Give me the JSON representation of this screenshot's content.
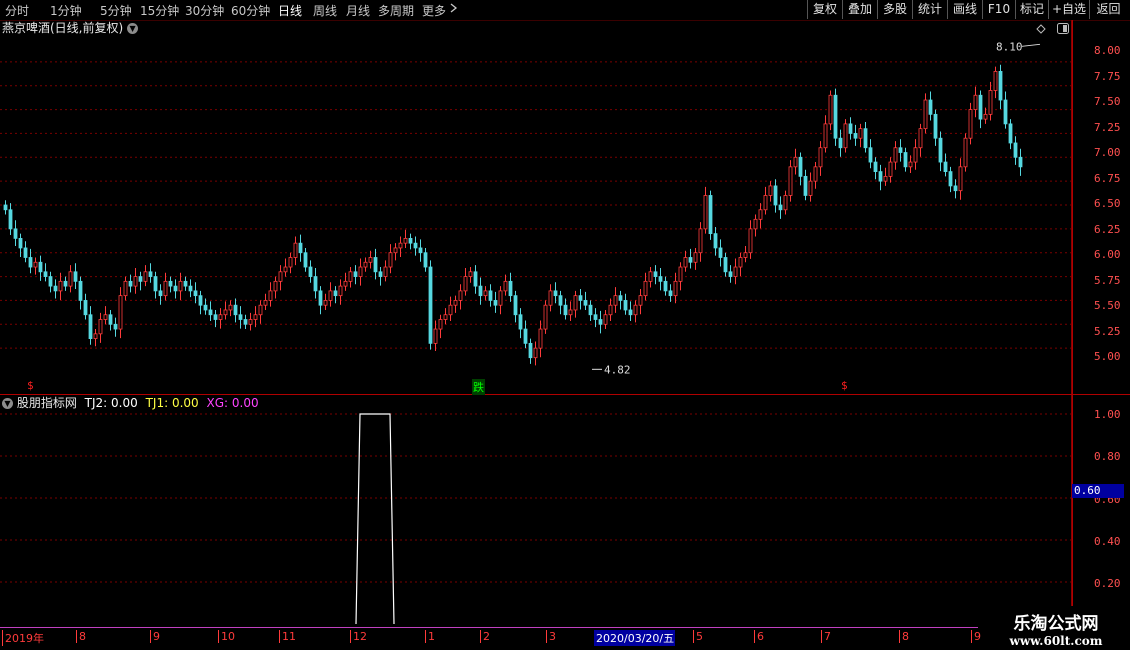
{
  "toolbar": {
    "periods": [
      "分时",
      "1分钟",
      "5分钟",
      "15分钟",
      "30分钟",
      "60分钟",
      "日线",
      "周线",
      "月线",
      "多周期",
      "更多"
    ],
    "active_period": "日线",
    "more_arrow": "chevron-right-icon",
    "buttons": [
      "复权",
      "叠加",
      "多股",
      "统计",
      "画线",
      "F10",
      "标记",
      "+自选",
      "返回"
    ]
  },
  "main_chart": {
    "title": "燕京啤酒(日线,前复权)",
    "y_labels": [
      "8.00",
      "7.75",
      "7.50",
      "7.25",
      "7.00",
      "6.75",
      "6.50",
      "6.25",
      "6.00",
      "5.75",
      "5.50",
      "5.25",
      "5.00"
    ],
    "high_label": "8.10",
    "low_label": "4.82",
    "markers": [
      {
        "text": "$",
        "color": "#ff2020"
      },
      {
        "text": "跌",
        "color": "#00ff00"
      },
      {
        "text": "$",
        "color": "#ff2020"
      }
    ],
    "colors": {
      "up": "#ff3b3b",
      "down": "#56d8e0",
      "grid": "#7a0000",
      "axis": "#b00000"
    }
  },
  "indicator": {
    "name": "股朋指标网",
    "values": [
      {
        "label": "TJ2: 0.00",
        "color": "#ffffff"
      },
      {
        "label": "TJ1: 0.00",
        "color": "#ffff44"
      },
      {
        "label": "XG: 0.00",
        "color": "#ff44ff"
      }
    ],
    "y_labels": [
      "1.00",
      "0.80",
      "0.60",
      "0.40",
      "0.20"
    ],
    "current_value": "0.60",
    "signal": {
      "from_x_index": 71,
      "to_x_index": 77,
      "level": 1.0
    }
  },
  "time_axis": {
    "labels": [
      "2019年",
      "8",
      "9",
      "10",
      "11",
      "12",
      "1",
      "2",
      "3",
      "2020/03/20/五",
      "5",
      "6",
      "7",
      "8",
      "9"
    ]
  },
  "watermark": {
    "line1": "乐淘公式网",
    "line2": "www.60lt.com"
  },
  "chart_data": {
    "type": "candlestick",
    "title": "燕京啤酒(日线,前复权)",
    "ylim": [
      4.75,
      8.25
    ],
    "annotations": [
      {
        "text": "8.10",
        "value": 8.1
      },
      {
        "text": "4.82",
        "value": 4.82
      }
    ],
    "closes": [
      6.45,
      6.25,
      6.15,
      6.05,
      5.95,
      5.85,
      5.9,
      5.8,
      5.75,
      5.65,
      5.6,
      5.7,
      5.65,
      5.8,
      5.7,
      5.5,
      5.35,
      5.1,
      5.15,
      5.3,
      5.35,
      5.25,
      5.2,
      5.55,
      5.7,
      5.65,
      5.75,
      5.7,
      5.8,
      5.75,
      5.6,
      5.55,
      5.7,
      5.65,
      5.6,
      5.7,
      5.65,
      5.6,
      5.55,
      5.45,
      5.4,
      5.35,
      5.3,
      5.35,
      5.4,
      5.45,
      5.35,
      5.3,
      5.25,
      5.3,
      5.35,
      5.45,
      5.5,
      5.6,
      5.7,
      5.8,
      5.85,
      5.95,
      6.1,
      6.0,
      5.85,
      5.75,
      5.6,
      5.45,
      5.5,
      5.6,
      5.55,
      5.65,
      5.7,
      5.8,
      5.75,
      5.85,
      5.9,
      5.95,
      5.8,
      5.75,
      5.85,
      6.0,
      6.05,
      6.1,
      6.15,
      6.1,
      6.05,
      6.0,
      5.85,
      5.05,
      5.2,
      5.3,
      5.35,
      5.45,
      5.5,
      5.6,
      5.75,
      5.8,
      5.65,
      5.55,
      5.6,
      5.5,
      5.45,
      5.6,
      5.7,
      5.55,
      5.35,
      5.2,
      5.05,
      4.9,
      5.0,
      5.2,
      5.45,
      5.6,
      5.55,
      5.45,
      5.35,
      5.4,
      5.55,
      5.5,
      5.45,
      5.35,
      5.3,
      5.25,
      5.35,
      5.45,
      5.55,
      5.5,
      5.4,
      5.35,
      5.45,
      5.55,
      5.7,
      5.8,
      5.75,
      5.7,
      5.6,
      5.55,
      5.7,
      5.85,
      5.95,
      5.9,
      6.0,
      6.25,
      6.6,
      6.2,
      6.05,
      5.95,
      5.8,
      5.75,
      5.85,
      5.95,
      6.0,
      6.25,
      6.35,
      6.45,
      6.6,
      6.7,
      6.5,
      6.45,
      6.6,
      6.9,
      7.0,
      6.8,
      6.6,
      6.75,
      6.9,
      7.1,
      7.35,
      7.65,
      7.2,
      7.1,
      7.35,
      7.25,
      7.2,
      7.3,
      7.1,
      6.95,
      6.85,
      6.75,
      6.8,
      6.95,
      7.1,
      7.05,
      6.9,
      6.95,
      7.1,
      7.3,
      7.6,
      7.45,
      7.2,
      6.95,
      6.85,
      6.7,
      6.65,
      6.9,
      7.2,
      7.5,
      7.65,
      7.4,
      7.45,
      7.7,
      7.9,
      7.6,
      7.35,
      7.15,
      7.0,
      6.9
    ]
  }
}
